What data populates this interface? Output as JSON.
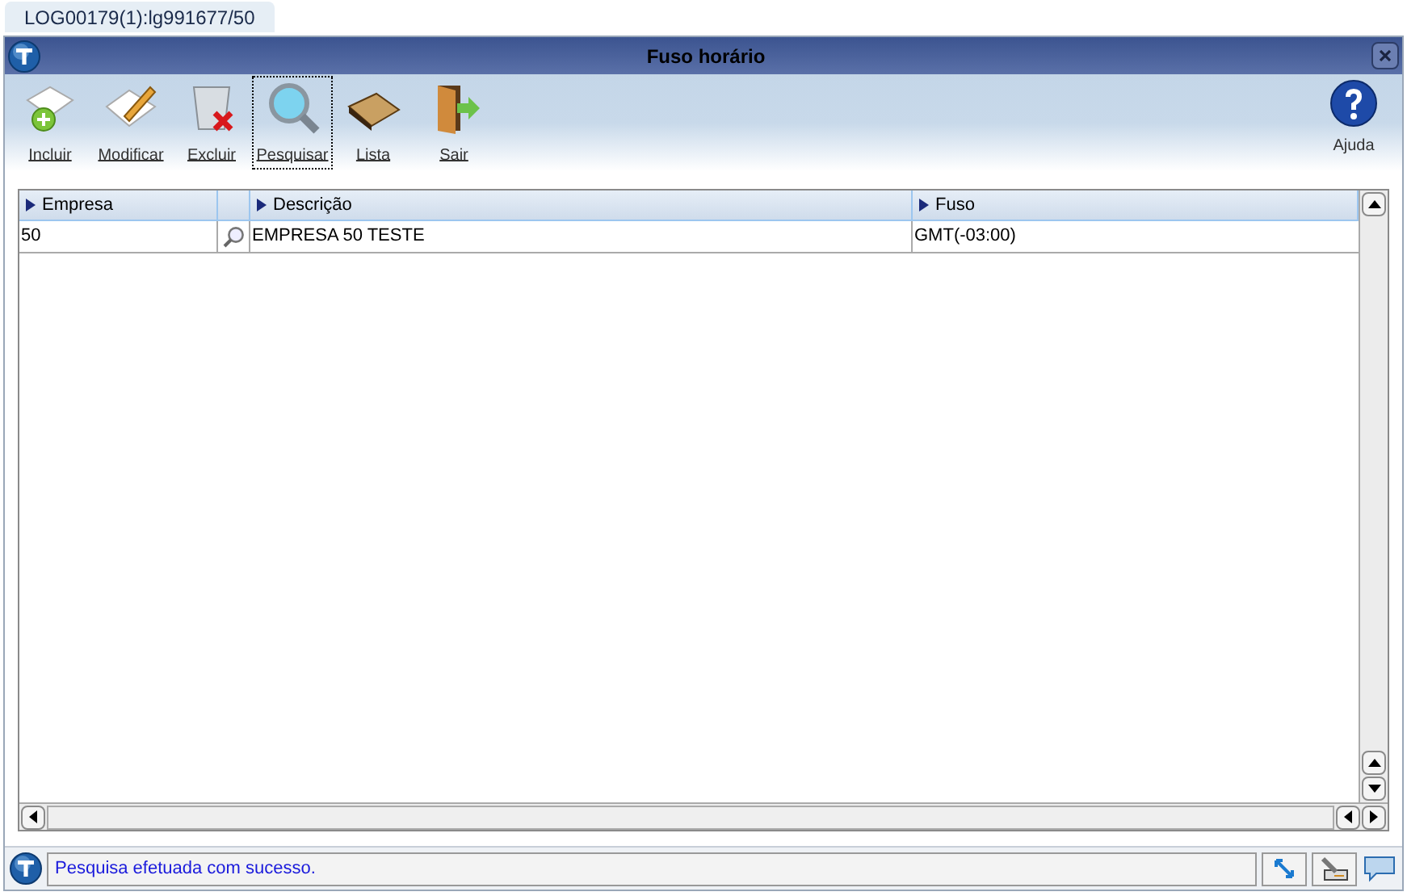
{
  "tab": {
    "label": "LOG00179(1):lg991677/50"
  },
  "window": {
    "title": "Fuso horário"
  },
  "toolbar": [
    {
      "label": "Incluir",
      "kind": "add",
      "selected": false
    },
    {
      "label": "Modificar",
      "kind": "edit",
      "selected": false
    },
    {
      "label": "Excluir",
      "kind": "delete",
      "selected": false
    },
    {
      "label": "Pesquisar",
      "kind": "search",
      "selected": true
    },
    {
      "label": "Lista",
      "kind": "list",
      "selected": false
    },
    {
      "label": "Sair",
      "kind": "exit",
      "selected": false
    }
  ],
  "help": {
    "label": "Ajuda"
  },
  "table": {
    "columns": [
      "Empresa",
      "Descrição",
      "Fuso"
    ],
    "rows": [
      {
        "empresa": "50",
        "descricao": "EMPRESA 50 TESTE",
        "fuso": "GMT(-03:00)"
      }
    ]
  },
  "status_bar": {
    "message": "Pesquisa efetuada com sucesso."
  }
}
